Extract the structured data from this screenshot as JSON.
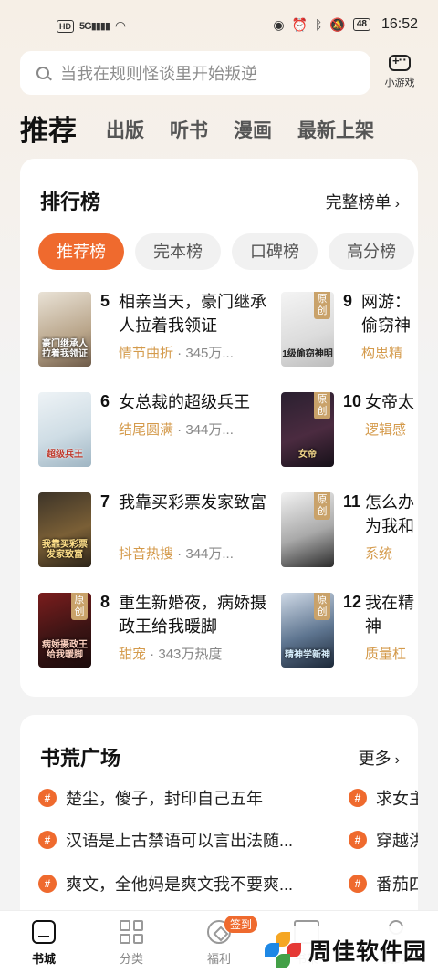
{
  "status_bar": {
    "left_badge": "HD",
    "signal": "5G",
    "battery": "48",
    "time": "16:52"
  },
  "search": {
    "placeholder": "当我在规则怪谈里开始叛逆"
  },
  "game_entry": {
    "label": "小游戏"
  },
  "top_tabs": [
    "推荐",
    "出版",
    "听书",
    "漫画",
    "最新上架"
  ],
  "ranking": {
    "title": "排行榜",
    "more_label": "完整榜单",
    "tabs": [
      "推荐榜",
      "完本榜",
      "口碑榜",
      "高分榜"
    ],
    "cover_badge": "原创",
    "books": [
      {
        "rank": "5",
        "title": "相亲当天，豪门继承人拉着我领证",
        "tag": "情节曲折",
        "heat": "345万...",
        "cover_text": "豪门继承人拉着我领证"
      },
      {
        "rank": "6",
        "title": "女总裁的超级兵王",
        "tag": "结尾圆满",
        "heat": "344万...",
        "cover_text": "超级兵王"
      },
      {
        "rank": "7",
        "title": "我靠买彩票发家致富",
        "tag": "抖音热搜",
        "heat": "344万...",
        "cover_text": "我靠买彩票发家致富"
      },
      {
        "rank": "8",
        "title": "重生新婚夜，病娇摄政王给我暖脚",
        "tag": "甜宠",
        "heat": "343万热度",
        "cover_text": "病娇摄政王给我暖脚"
      },
      {
        "rank": "9",
        "title": "网游：偷窃神",
        "tag": "构思精",
        "heat": "",
        "cover_text": "1级偷窃神明"
      },
      {
        "rank": "10",
        "title": "女帝太",
        "tag": "逻辑感",
        "heat": "",
        "cover_text": "女帝"
      },
      {
        "rank": "11",
        "title": "怎么办为我和",
        "tag": "系统",
        "heat": "",
        "cover_text": ""
      },
      {
        "rank": "12",
        "title": "我在精神",
        "tag": "质量杠",
        "heat": "",
        "cover_text": "精神学新神"
      }
    ]
  },
  "plaza": {
    "title": "书荒广场",
    "more_label": "更多",
    "topics_left": [
      "楚尘，傻子，封印自己五年",
      "汉语是上古禁语可以言出法随...",
      "爽文，全他妈是爽文我不要爽..."
    ],
    "topics_right": [
      "求女主",
      "穿越洪",
      "番茄四"
    ]
  },
  "bottom_nav": {
    "items": [
      "书城",
      "分类",
      "福利",
      "书架",
      "我的"
    ],
    "checkin_badge": "签到"
  },
  "watermark": {
    "text": "周佳软件园"
  },
  "colors": {
    "accent": "#ef6a2e",
    "tag": "#d49a4b",
    "badge": "#c9a26a"
  }
}
